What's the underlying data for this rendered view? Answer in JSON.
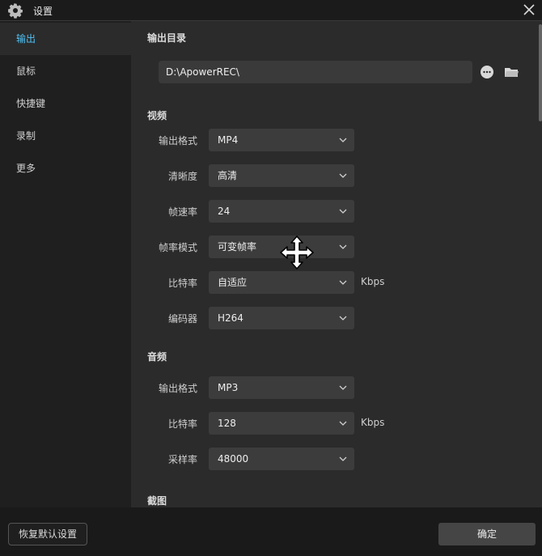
{
  "window": {
    "title": "设置"
  },
  "sidebar": {
    "items": [
      {
        "label": "输出",
        "active": true
      },
      {
        "label": "鼠标",
        "active": false
      },
      {
        "label": "快捷键",
        "active": false
      },
      {
        "label": "录制",
        "active": false
      },
      {
        "label": "更多",
        "active": false
      }
    ]
  },
  "output_dir": {
    "title": "输出目录",
    "path": "D:\\ApowerREC\\"
  },
  "video": {
    "title": "视频",
    "format": {
      "label": "输出格式",
      "value": "MP4"
    },
    "quality": {
      "label": "清晰度",
      "value": "高清"
    },
    "fps": {
      "label": "帧速率",
      "value": "24"
    },
    "fps_mode": {
      "label": "帧率模式",
      "value": "可变帧率"
    },
    "bitrate": {
      "label": "比特率",
      "value": "自适应",
      "unit": "Kbps"
    },
    "encoder": {
      "label": "编码器",
      "value": "H264"
    }
  },
  "audio": {
    "title": "音频",
    "format": {
      "label": "输出格式",
      "value": "MP3"
    },
    "bitrate": {
      "label": "比特率",
      "value": "128",
      "unit": "Kbps"
    },
    "sample_rate": {
      "label": "采样率",
      "value": "48000"
    }
  },
  "screenshot": {
    "title": "截图"
  },
  "footer": {
    "reset_label": "恢复默认设置",
    "ok_label": "确定"
  },
  "colors": {
    "accent": "#4fc3f7",
    "background": "#2b2b2b",
    "sidebar": "#1f1f1f",
    "footer": "#1a1a1a"
  }
}
